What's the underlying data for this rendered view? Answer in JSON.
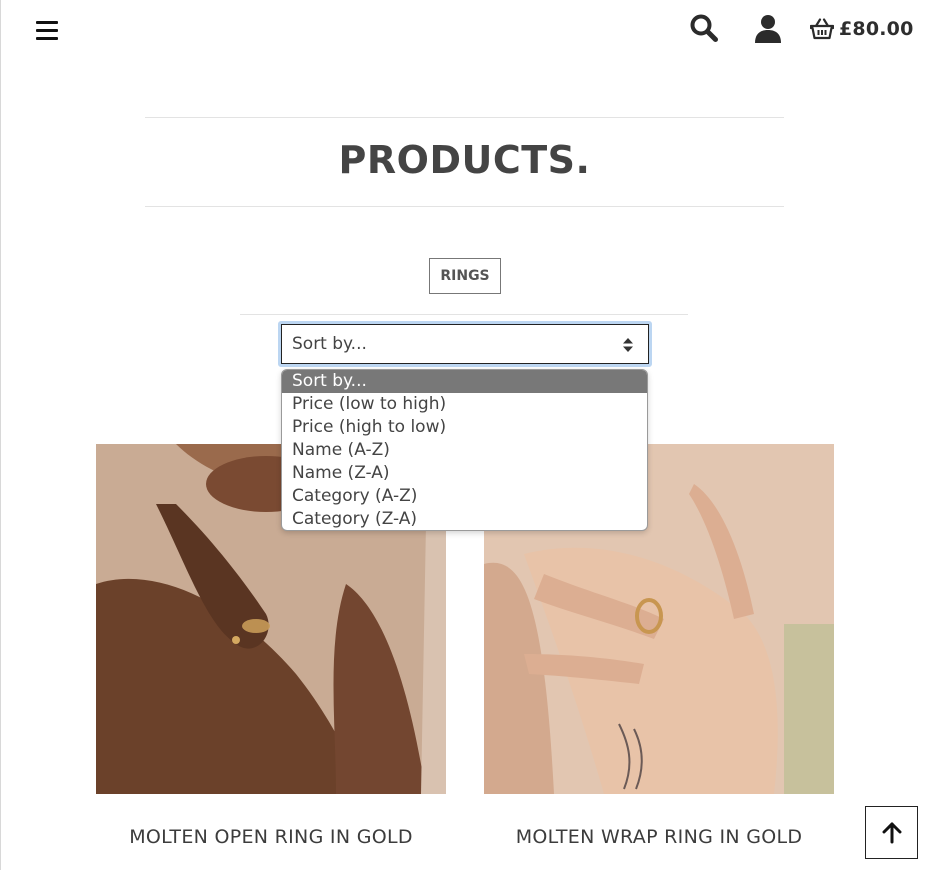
{
  "header": {
    "menu_icon": "hamburger-icon",
    "search_icon": "search-icon",
    "account_icon": "user-icon",
    "basket_icon": "basket-icon",
    "basket_total": "£80.00"
  },
  "page": {
    "title": "PRODUCTS.",
    "category_tag": "RINGS"
  },
  "sort": {
    "current": "Sort by...",
    "options": [
      "Sort by...",
      "Price (low to high)",
      "Price (high to low)",
      "Name (A-Z)",
      "Name (Z-A)",
      "Category (A-Z)",
      "Category (Z-A)"
    ],
    "selected_index": 0
  },
  "products": [
    {
      "name": "MOLTEN OPEN RING IN GOLD"
    },
    {
      "name": "MOLTEN WRAP RING IN GOLD"
    }
  ],
  "back_to_top_icon": "arrow-up-icon",
  "colors": {
    "text": "#3b3b3b",
    "selected_option_bg": "#787878",
    "focus_ring": "#bcd6f2"
  }
}
